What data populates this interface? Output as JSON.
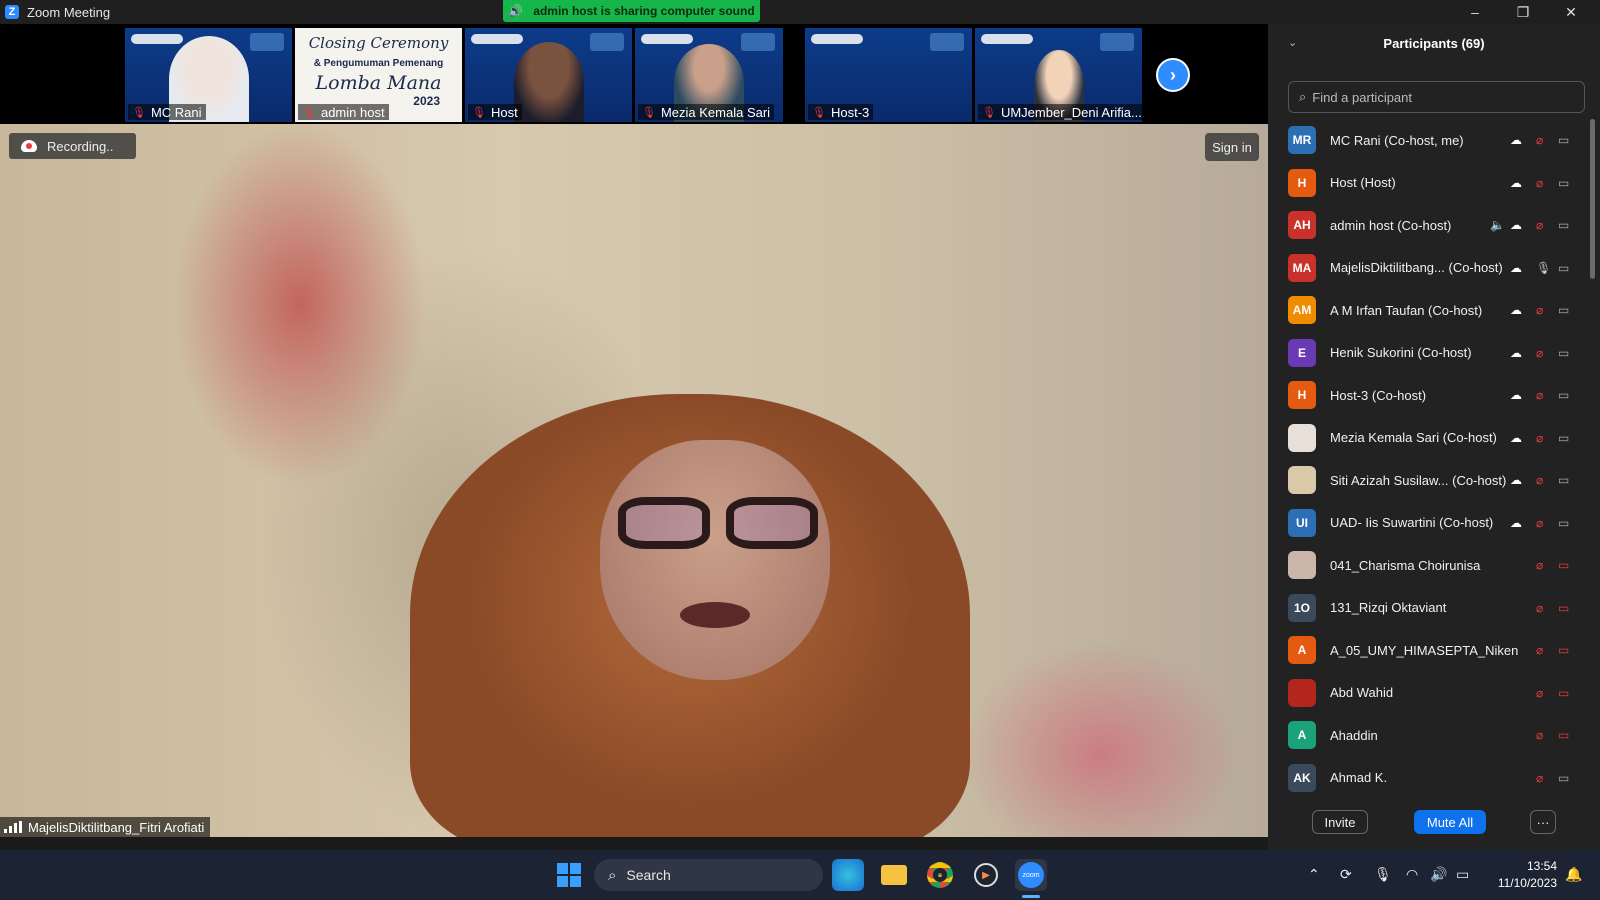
{
  "window": {
    "title": "Zoom Meeting",
    "minimize": "–",
    "restore": "❐",
    "close": "✕"
  },
  "banner": {
    "text": "admin host is sharing computer sound",
    "icon": "speaker-icon"
  },
  "gallery": {
    "tiles": [
      {
        "name": "MC Rani",
        "muted": true
      },
      {
        "name": "admin host",
        "muted": true
      },
      {
        "name": "Host",
        "muted": true
      },
      {
        "name": "Mezia Kemala Sari",
        "muted": true
      },
      {
        "name": "Host-3",
        "muted": true
      },
      {
        "name": "UMJember_Deni Arifia...",
        "muted": true
      }
    ],
    "next_icon": "chevron-right-icon",
    "slide": {
      "line1": "Closing Ceremony",
      "line2": "& Pengumuman Pemenang",
      "line3": "Lomba Mana",
      "line4": "2023"
    }
  },
  "main_video": {
    "recording_label": "Recording..",
    "signin_label": "Sign in",
    "speaker_name": "MajelisDiktilitbang_Fitri Arofiati"
  },
  "participants": {
    "title": "Participants (69)",
    "search_placeholder": "Find a participant",
    "list": [
      {
        "initials": "MR",
        "name": "MC Rani (Co-host, me)",
        "color": "#2d6fb5",
        "cloud": true,
        "mic": "muted",
        "cam": "on"
      },
      {
        "initials": "H",
        "name": "Host (Host)",
        "color": "#e35a10",
        "cloud": true,
        "mic": "muted",
        "cam": "on"
      },
      {
        "initials": "AH",
        "name": "admin host (Co-host)",
        "color": "#c9322b",
        "cloud": true,
        "speaking": true,
        "mic": "muted",
        "cam": "on"
      },
      {
        "initials": "MA",
        "name": "MajelisDiktilitbang... (Co-host)",
        "color": "#c9322b",
        "cloud": true,
        "mic": "on",
        "cam": "on"
      },
      {
        "initials": "AM",
        "name": "A M Irfan Taufan (Co-host)",
        "color": "#f08c00",
        "cloud": true,
        "mic": "muted",
        "cam": "on"
      },
      {
        "initials": "E",
        "name": "Henik Sukorini (Co-host)",
        "color": "#6a3ab5",
        "cloud": true,
        "mic": "muted",
        "cam": "on"
      },
      {
        "initials": "H",
        "name": "Host-3 (Co-host)",
        "color": "#e35a10",
        "cloud": true,
        "mic": "muted",
        "cam": "on"
      },
      {
        "initials": "",
        "name": "Mezia Kemala Sari (Co-host)",
        "color": "#e8e0d8",
        "photo": true,
        "cloud": true,
        "mic": "muted",
        "cam": "on"
      },
      {
        "initials": "",
        "name": "Siti Azizah Susilaw... (Co-host)",
        "color": "#d9c9a8",
        "photo": true,
        "cloud": true,
        "mic": "muted",
        "cam": "on"
      },
      {
        "initials": "UI",
        "name": "UAD- Iis Suwartini (Co-host)",
        "color": "#2d6fb5",
        "cloud": true,
        "mic": "muted",
        "cam": "on"
      },
      {
        "initials": "",
        "name": "041_Charisma Choirunisa",
        "color": "#c9b6a8",
        "photo": true,
        "cloud": false,
        "mic": "muted",
        "cam": "off"
      },
      {
        "initials": "1O",
        "name": "131_Rizqi Oktaviant",
        "color": "#3a4a5c",
        "cloud": false,
        "mic": "muted",
        "cam": "off"
      },
      {
        "initials": "A",
        "name": "A_05_UMY_HIMASEPTA_Niken",
        "color": "#e35a10",
        "cloud": false,
        "mic": "muted",
        "cam": "off"
      },
      {
        "initials": "",
        "name": "Abd Wahid",
        "color": "#b3261e",
        "photo": true,
        "cloud": false,
        "mic": "muted",
        "cam": "off"
      },
      {
        "initials": "A",
        "name": "Ahaddin",
        "color": "#1aa37a",
        "cloud": false,
        "mic": "muted",
        "cam": "off"
      },
      {
        "initials": "AK",
        "name": "Ahmad K.",
        "color": "#3a4a5c",
        "cloud": false,
        "mic": "muted",
        "cam": "on"
      }
    ],
    "invite_label": "Invite",
    "mute_all_label": "Mute All",
    "more_label": "···"
  },
  "taskbar": {
    "search_label": "Search",
    "time": "13:54",
    "date": "11/10/2023"
  }
}
